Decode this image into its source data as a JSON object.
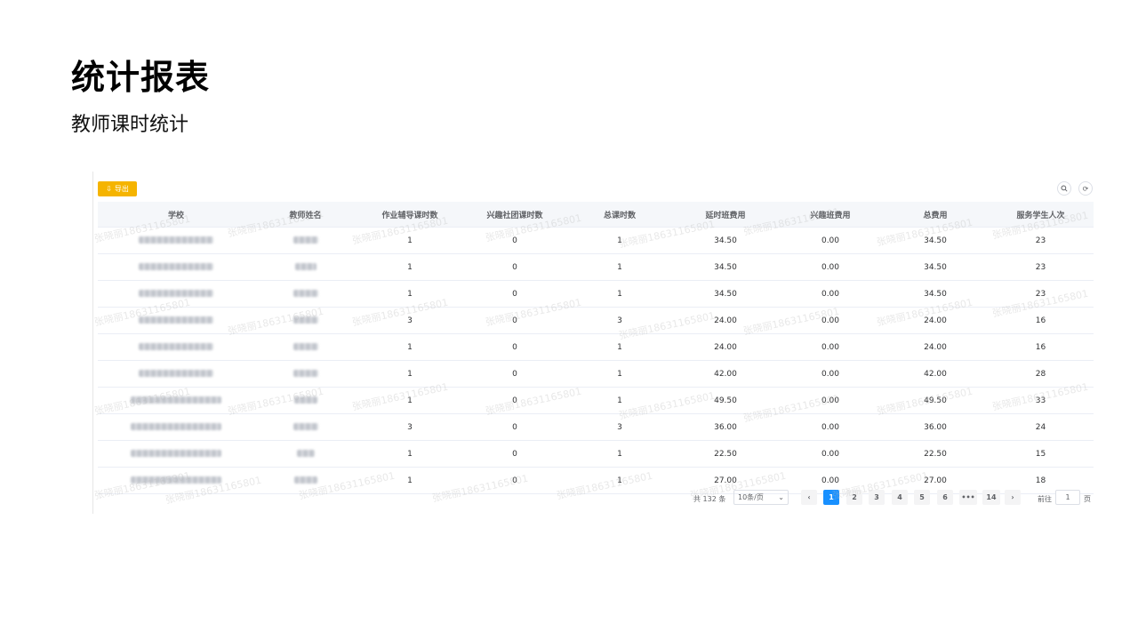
{
  "slide": {
    "title": "统计报表",
    "subtitle": "教师课时统计"
  },
  "toolbar": {
    "export_label": "导出",
    "export_icon": "download-icon",
    "search_icon": "search-icon",
    "refresh_icon": "refresh-icon"
  },
  "table": {
    "columns": [
      "学校",
      "教师姓名",
      "作业辅导课时数",
      "兴趣社团课时数",
      "总课时数",
      "延时班费用",
      "兴趣班费用",
      "总费用",
      "服务学生人次"
    ],
    "rows": [
      {
        "homework": "1",
        "club": "0",
        "total_hours": "1",
        "delay_fee": "34.50",
        "interest_fee": "0.00",
        "total_fee": "34.50",
        "students": "23"
      },
      {
        "homework": "1",
        "club": "0",
        "total_hours": "1",
        "delay_fee": "34.50",
        "interest_fee": "0.00",
        "total_fee": "34.50",
        "students": "23"
      },
      {
        "homework": "1",
        "club": "0",
        "total_hours": "1",
        "delay_fee": "34.50",
        "interest_fee": "0.00",
        "total_fee": "34.50",
        "students": "23"
      },
      {
        "homework": "3",
        "club": "0",
        "total_hours": "3",
        "delay_fee": "24.00",
        "interest_fee": "0.00",
        "total_fee": "24.00",
        "students": "16"
      },
      {
        "homework": "1",
        "club": "0",
        "total_hours": "1",
        "delay_fee": "24.00",
        "interest_fee": "0.00",
        "total_fee": "24.00",
        "students": "16"
      },
      {
        "homework": "1",
        "club": "0",
        "total_hours": "1",
        "delay_fee": "42.00",
        "interest_fee": "0.00",
        "total_fee": "42.00",
        "students": "28"
      },
      {
        "homework": "1",
        "club": "0",
        "total_hours": "1",
        "delay_fee": "49.50",
        "interest_fee": "0.00",
        "total_fee": "49.50",
        "students": "33"
      },
      {
        "homework": "3",
        "club": "0",
        "total_hours": "3",
        "delay_fee": "36.00",
        "interest_fee": "0.00",
        "total_fee": "36.00",
        "students": "24"
      },
      {
        "homework": "1",
        "club": "0",
        "total_hours": "1",
        "delay_fee": "22.50",
        "interest_fee": "0.00",
        "total_fee": "22.50",
        "students": "15"
      },
      {
        "homework": "1",
        "club": "0",
        "total_hours": "1",
        "delay_fee": "27.00",
        "interest_fee": "0.00",
        "total_fee": "27.00",
        "students": "18"
      }
    ]
  },
  "watermark": {
    "text": "张晓丽18631165801"
  },
  "pagination": {
    "total_text": "共 132 条",
    "page_size": "10条/页",
    "pages": [
      "1",
      "2",
      "3",
      "4",
      "5",
      "6",
      "•••",
      "14"
    ],
    "current": "1",
    "prev_icon": "chevron-left-icon",
    "next_icon": "chevron-right-icon",
    "goto_label": "前往",
    "goto_value": "1",
    "goto_suffix": "页"
  }
}
